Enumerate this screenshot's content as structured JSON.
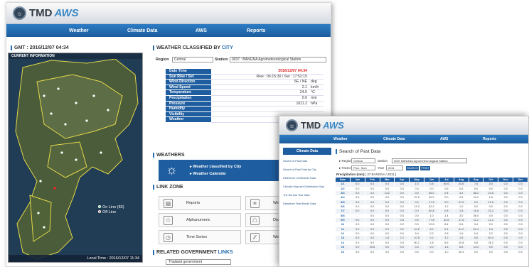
{
  "win1": {
    "logo": {
      "tmd": "TMD",
      "aws": "AWS"
    },
    "nav": [
      "Weather",
      "Climate Data",
      "AWS",
      "Reports"
    ],
    "gmt_title": "GMT : 2016/12/07 04:34",
    "map": {
      "header": "CURRENT INFORMATION",
      "online": "On Line (83)",
      "offline": "Off Line",
      "local_time": "Local Time : 2016/12/07 11:34"
    },
    "city": {
      "title_pre": "WEATHER CLASSIFIED BY ",
      "title_hl": "CITY",
      "region_label": "Region",
      "region_value": "Central",
      "station_label": "Station",
      "station_value": "0037 : BANGNA Agrometeorological Station",
      "rows": [
        {
          "k": "Date Time",
          "v": "2016/12/07 04:34",
          "u": ""
        },
        {
          "k": "Sun Rise / Set",
          "v": "Rise : 06:15:30  /  Set : 17:52:15",
          "u": ""
        },
        {
          "k": "Wind Direction",
          "v": "SE / NE",
          "u": "deg"
        },
        {
          "k": "Wind Speed",
          "v": "2.1",
          "u": "km/h"
        },
        {
          "k": "Temperature",
          "v": "24.5",
          "u": "°C"
        },
        {
          "k": "Precipitation",
          "v": "0.0",
          "u": "mm"
        },
        {
          "k": "Pressure",
          "v": "1011.2",
          "u": "hPa"
        },
        {
          "k": "Humidity",
          "v": "",
          "u": ""
        },
        {
          "k": "Visibility",
          "v": "",
          "u": ""
        },
        {
          "k": "Weather",
          "v": "No Pr",
          "u": ""
        }
      ]
    },
    "weathers": {
      "title": "WEATHERS",
      "l1": "Weather classified by City",
      "l2": "Weather Calendar"
    },
    "linkzone": {
      "title": "LINK ZONE",
      "links": [
        "Reports",
        "Alphanumeric",
        "Time Series"
      ],
      "right_links": [
        "Wind R",
        "Distribu",
        "Weath"
      ]
    },
    "gov": {
      "title_pre": "RELATED GOVERNMENT ",
      "title_hl": "LINKS",
      "select": "Thailand government"
    }
  },
  "win2": {
    "logo": {
      "tmd": "TMD",
      "aws": "AWS"
    },
    "nav": [
      "Weather",
      "Climate Data",
      "AWS",
      "Reports"
    ],
    "side_button": "Climate Data",
    "side_links": [
      "Search of Past Data",
      "Search of Past Data by City",
      "Reference of Weather Data",
      "Climatic Map and Distribution Map",
      "The Normal Year Data",
      "Departure Year/Month Data"
    ],
    "title": "Search of Past Data",
    "region_label": "Region",
    "region_value": "Central",
    "station_label": "Station",
    "station_value": "0037 BANGNA Agrometeorological Station",
    "factor_label": "Factor",
    "factor_value": "Prec. Sum",
    "year_label": "Year",
    "year_value": "2011",
    "search_btn": "SEARCH",
    "print_btn": "PRINT",
    "precip_label": "Precipitation (mm)",
    "precip_station": "[ 37  BANGNA / 2011 ]",
    "table": {
      "headers": [
        "Date",
        "Jan",
        "Feb",
        "Mar",
        "Apr",
        "May",
        "Jun",
        "Jul",
        "Aug",
        "Sep",
        "Oct",
        "Nov",
        "Dec"
      ],
      "rows": [
        [
          "1/1",
          "0.0",
          "0.0",
          "0.0",
          "0.0",
          "1.5",
          "0.8",
          "60.6",
          "20.6",
          "7.6",
          "0.0",
          "0.0",
          "0.0"
        ],
        [
          "2/2",
          "0.0",
          "0.0",
          "0.0",
          "0.0",
          "0.0",
          "0.0",
          "0.6",
          "0.6",
          "0.0",
          "0.0",
          "0.0",
          "0.0"
        ],
        [
          "3/3",
          "0.0",
          "0.0",
          "13.2",
          "0.0",
          "0.0",
          "66.0",
          "0.4",
          "3.2",
          "68.2",
          "22.8",
          "0.0",
          "0.0"
        ],
        [
          "4/4",
          "0.0",
          "0.0",
          "0.0",
          "0.0",
          "97.6",
          "30.2",
          "0.0",
          "2.6",
          "19.2",
          "1.6",
          "0.0",
          "0.0"
        ],
        [
          "5/5",
          "0.0",
          "0.0",
          "0.0",
          "0.0",
          "0.0",
          "17.8",
          "0.0",
          "37.6",
          "0.0",
          "10.6",
          "0.0",
          "0.0"
        ],
        [
          "6/6",
          "0.0",
          "0.0",
          "0.0",
          "0.0",
          "13.0",
          "62.2",
          "1.2",
          "1.0",
          "0.0",
          "0.0",
          "0.0",
          "0.0"
        ],
        [
          "7/7",
          "0.0",
          "0.0",
          "0.0",
          "0.0",
          "0.0",
          "60.8",
          "0.8",
          "1.8",
          "16.6",
          "22.2",
          "0.0",
          "0.0"
        ],
        [
          "8/8",
          "-",
          "0.0",
          "0.0",
          "0.0",
          "0.0",
          "1.0",
          "1.4",
          "3.0",
          "38.0",
          "0.0",
          "0.0",
          "0.0"
        ],
        [
          "9/9",
          "0.0",
          "0.0",
          "0.0",
          "0.6",
          "0.0",
          "77.8",
          "32.6",
          "17.6",
          "12.2",
          "11.2",
          "0.0",
          "0.0"
        ],
        [
          "10",
          "0.0",
          "0.0",
          "0.0",
          "0.2",
          "0.0",
          "22.6",
          "8.4",
          "0.6",
          "3.4",
          "0.0",
          "0.0",
          "0.0"
        ],
        [
          "11",
          "0.0",
          "0.0",
          "0.0",
          "0.2",
          "10.5",
          "3.0",
          "6.1",
          "41.2",
          "20.4",
          "1.6",
          "0.0",
          "0.0"
        ],
        [
          "12",
          "0.0",
          "0.0",
          "0.0",
          "0.0",
          "9.4",
          "0.2",
          "2.8",
          "1.6",
          "0.4",
          "0.2",
          "0.0",
          "0.0"
        ],
        [
          "13",
          "0.0",
          "0.0",
          "1.6",
          "2.2",
          "10.8",
          "0.2",
          "3.2",
          "1.6",
          "0.6",
          "64.4",
          "0.0",
          "0.0"
        ],
        [
          "14",
          "0.0",
          "0.0",
          "0.0",
          "0.0",
          "60.2",
          "1.8",
          "6.6",
          "20.8",
          "0.8",
          "28.2",
          "0.0",
          "0.0"
        ],
        [
          "15",
          "0.0",
          "20.6",
          "0.0",
          "0.0",
          "0.4",
          "0.0",
          "1.6",
          "6.8",
          "14.0",
          "0.0",
          "0.0",
          "0.0"
        ],
        [
          "16",
          "0.0",
          "0.0",
          "0.0",
          "0.0",
          "0.0",
          "0.0",
          "1.0",
          "40.4",
          "0.0",
          "0.0",
          "0.0",
          "0.0"
        ]
      ]
    }
  }
}
